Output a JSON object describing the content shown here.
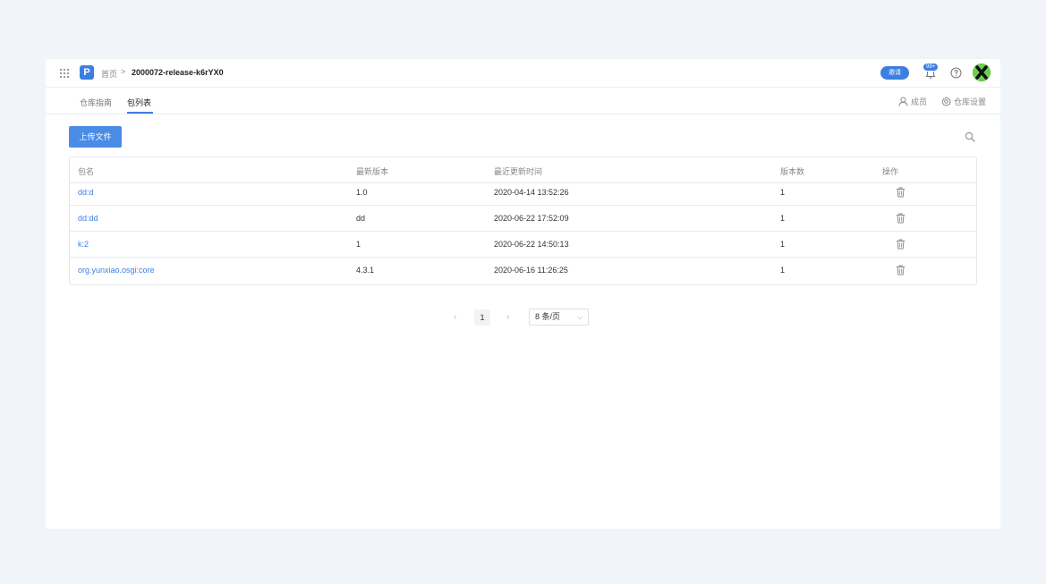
{
  "header": {
    "logo_letter": "P",
    "breadcrumb_home": "首页",
    "breadcrumb_sep": ">",
    "breadcrumb_current": "2000072-release-k6rYX0",
    "invite_label": "邀请",
    "notification_badge": "99+"
  },
  "tabs": [
    {
      "label": "仓库指南",
      "active": false
    },
    {
      "label": "包列表",
      "active": true
    }
  ],
  "actions": {
    "members_label": "成员",
    "settings_label": "仓库设置"
  },
  "toolbar": {
    "upload_label": "上传文件"
  },
  "table": {
    "columns": [
      "包名",
      "最新版本",
      "最近更新时间",
      "版本数",
      "操作"
    ],
    "rows": [
      {
        "name": "dd:d",
        "version": "1.0",
        "updated": "2020-04-14 13:52:26",
        "count": "1"
      },
      {
        "name": "dd:dd",
        "version": "dd",
        "updated": "2020-06-22 17:52:09",
        "count": "1"
      },
      {
        "name": "k:2",
        "version": "1",
        "updated": "2020-06-22 14:50:13",
        "count": "1"
      },
      {
        "name": "org.yunxiao.osgi:core",
        "version": "4.3.1",
        "updated": "2020-06-16 11:26:25",
        "count": "1"
      }
    ]
  },
  "pagination": {
    "current_page": "1",
    "page_size": "8 条/页"
  },
  "colors": {
    "accent": "#3c7fe0",
    "background": "#f1f4f9"
  }
}
